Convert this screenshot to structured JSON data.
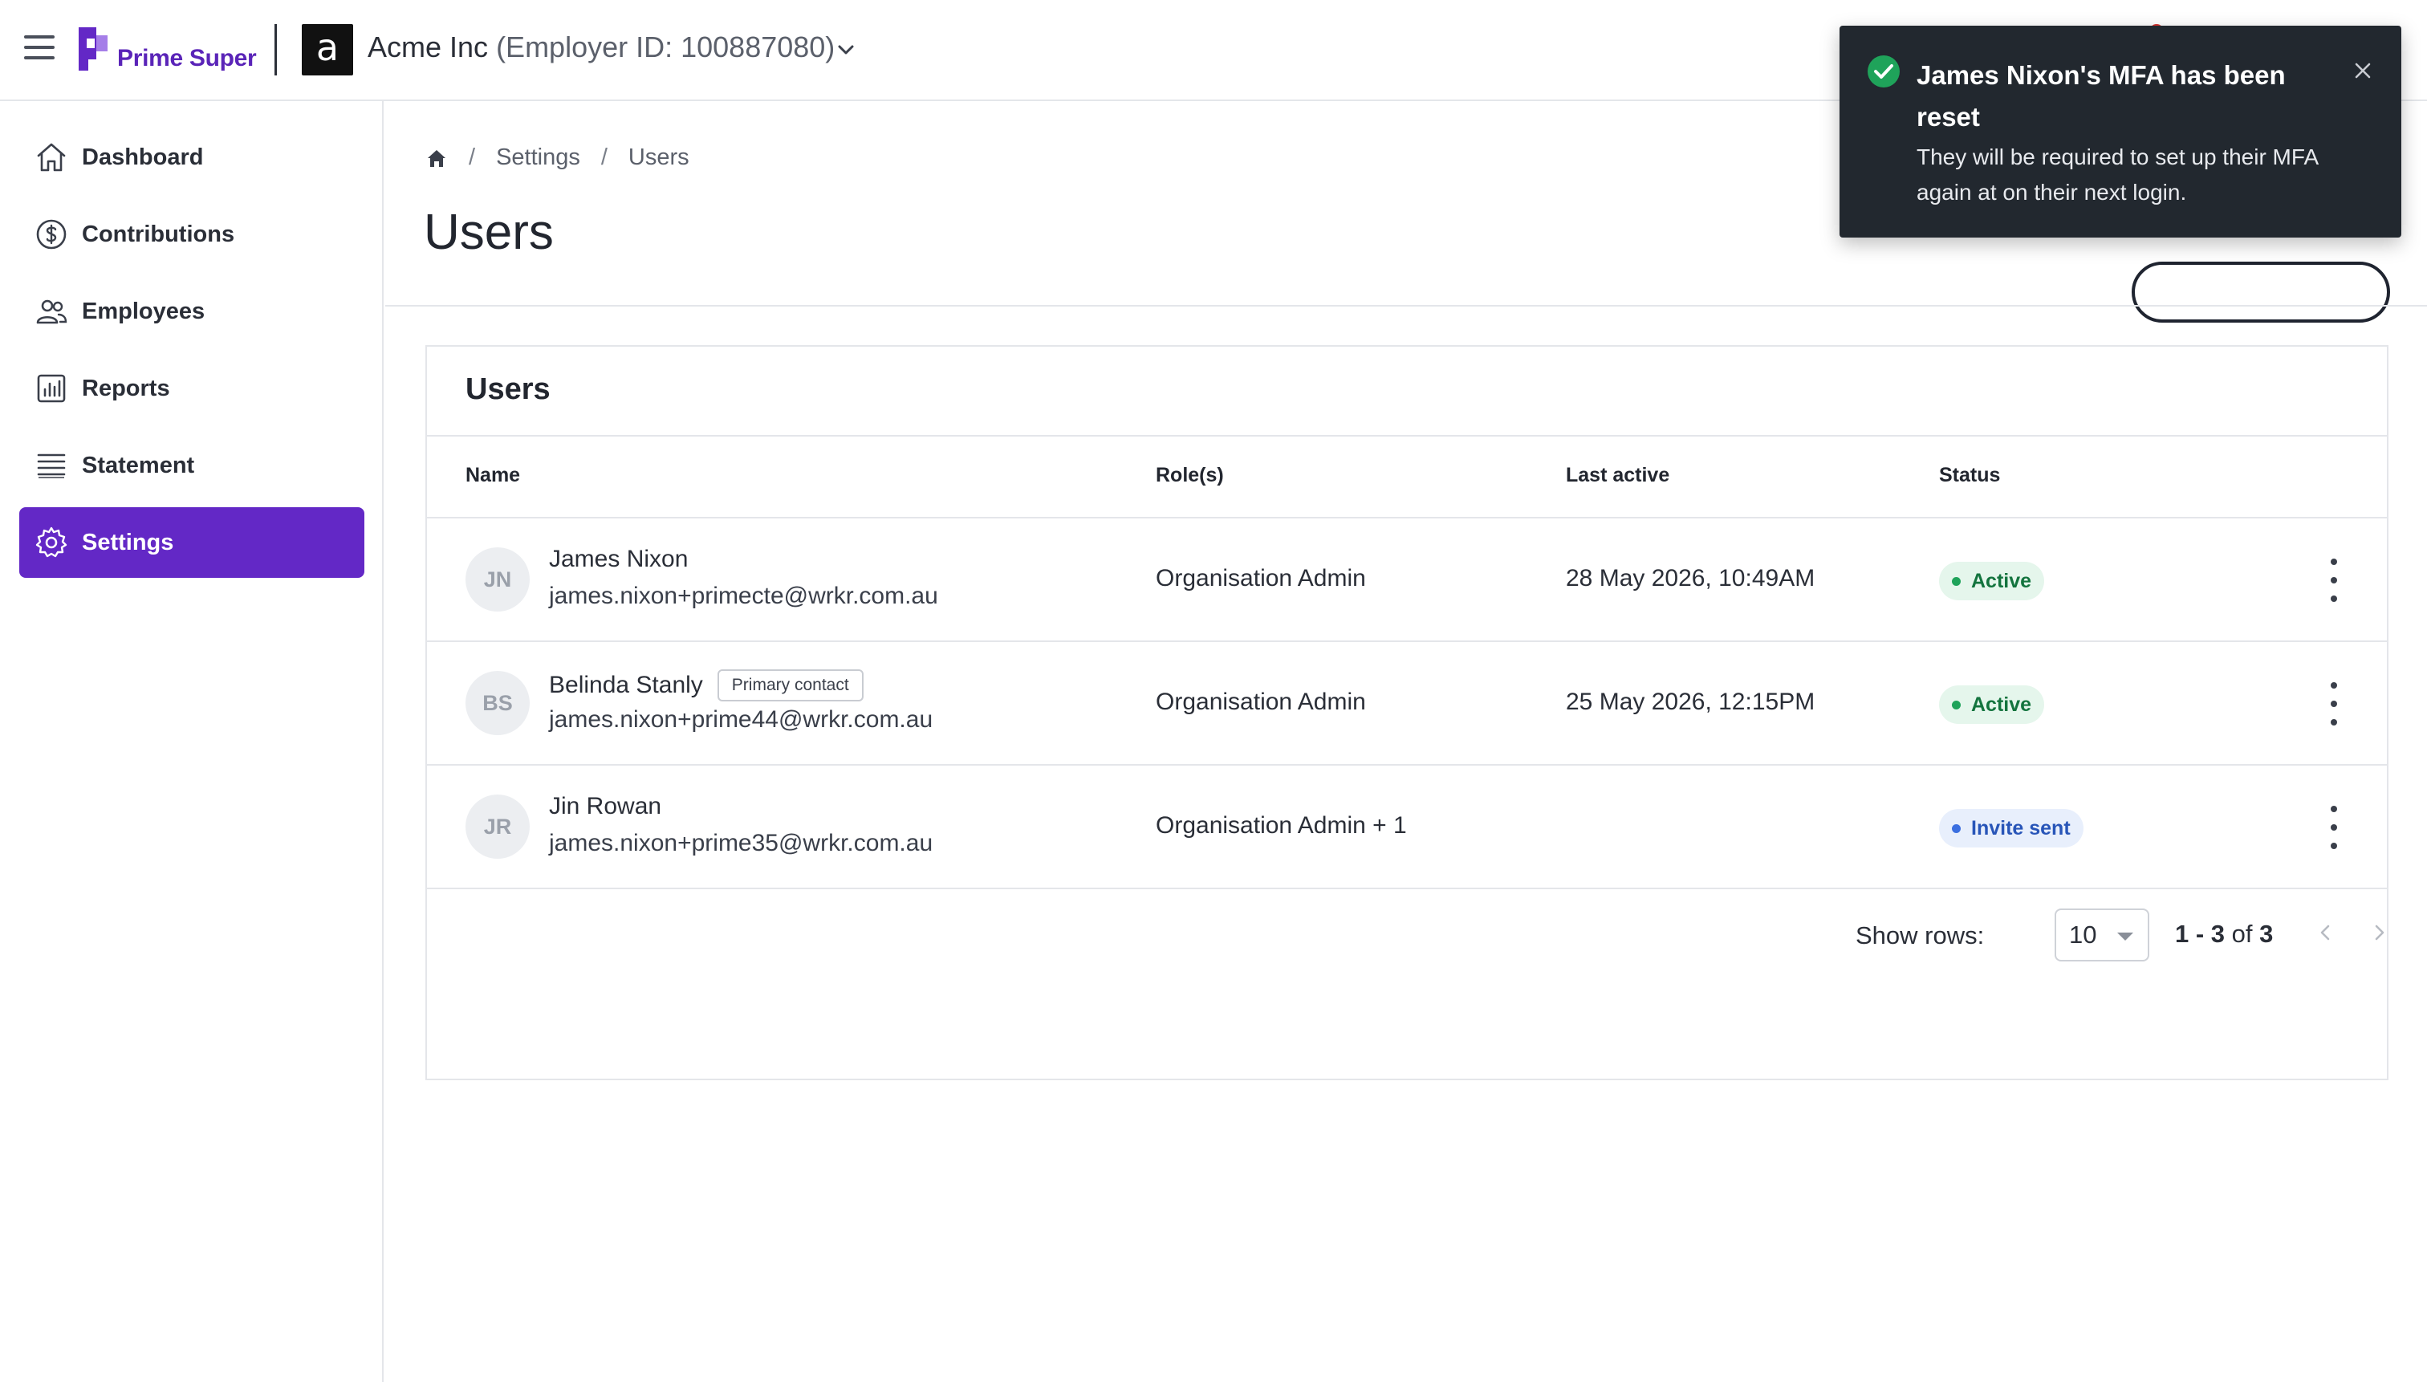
{
  "header": {
    "brand": "Prime Super",
    "employer_initial": "a",
    "employer_name": "Acme Inc",
    "employer_id": "(Employer ID: 100887080)"
  },
  "sidebar": {
    "items": [
      {
        "label": "Dashboard",
        "icon": "home-icon"
      },
      {
        "label": "Contributions",
        "icon": "dollar-icon"
      },
      {
        "label": "Employees",
        "icon": "people-icon"
      },
      {
        "label": "Reports",
        "icon": "report-chart-icon"
      },
      {
        "label": "Statement",
        "icon": "statement-list-icon"
      },
      {
        "label": "Settings",
        "icon": "gear-icon",
        "active": true
      }
    ]
  },
  "breadcrumb": {
    "items": [
      "Settings",
      "Users"
    ]
  },
  "page": {
    "title": "Users"
  },
  "card": {
    "title": "Users",
    "columns": [
      "Name",
      "Role(s)",
      "Last active",
      "Status"
    ],
    "rows": [
      {
        "initials": "JN",
        "name": "James Nixon",
        "tag": "",
        "email": "james.nixon+primecte@wrkr.com.au",
        "role": "Organisation Admin",
        "last_active": "28 May 2026, 10:49AM",
        "status": "Active"
      },
      {
        "initials": "BS",
        "name": "Belinda Stanly",
        "tag": "Primary contact",
        "email": "james.nixon+prime44@wrkr.com.au",
        "role": "Organisation Admin",
        "last_active": "25 May 2026, 12:15PM",
        "status": "Active"
      },
      {
        "initials": "JR",
        "name": "Jin Rowan",
        "tag": "",
        "email": "james.nixon+prime35@wrkr.com.au",
        "role": "Organisation Admin + 1",
        "last_active": "",
        "status": "Invite sent"
      }
    ]
  },
  "pagination": {
    "rows_label": "Show rows:",
    "rows_value": "10",
    "range": "1 - 3",
    "of": "of",
    "total": "3"
  },
  "toast": {
    "title": "James Nixon's MFA has been reset",
    "body": "They will be required to set up their MFA again at on their next login."
  },
  "colors": {
    "accent": "#6328c6",
    "toast_bg": "#22282f",
    "success": "#1fa35a",
    "active_badge_bg": "#e5f6ec",
    "invite_badge_bg": "#e8effc"
  }
}
